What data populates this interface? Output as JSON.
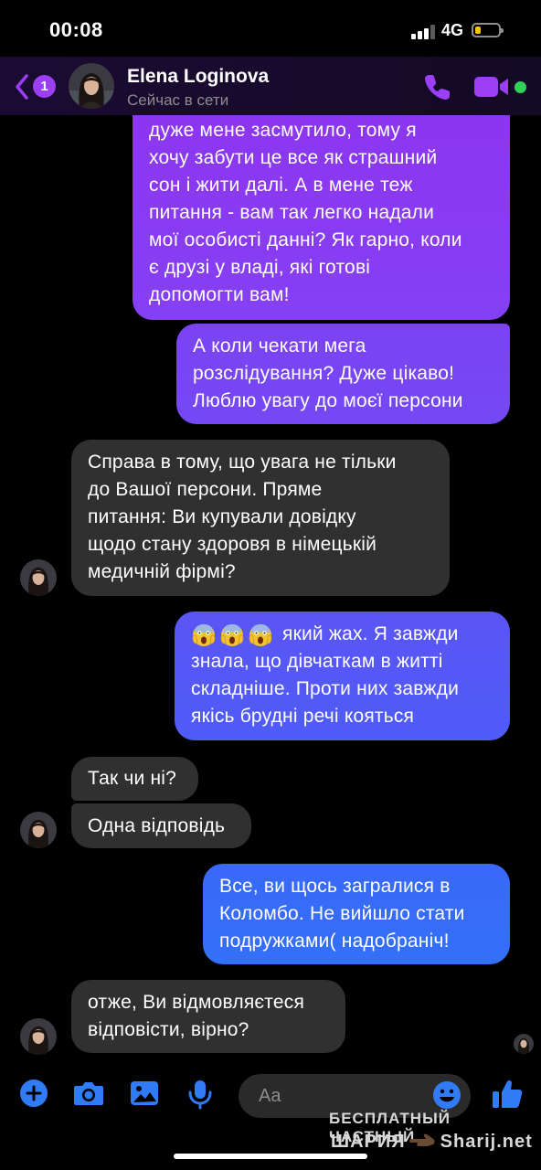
{
  "status_bar": {
    "time": "00:08",
    "network": "4G"
  },
  "header": {
    "unread_count": "1",
    "contact_name": "Elena Loginova",
    "contact_status": "Сейчас в сети",
    "accent_color": "#9a3ff5",
    "online_color": "#31d158"
  },
  "messages": [
    {
      "direction": "outgoing",
      "lines": [
        "дуже мене засмутило, тому я",
        "хочу забути це все як страшний",
        "сон і жити далі. А в мене теж",
        "питання - вам так легко надали",
        "мої особисті данні? Як гарно, коли",
        "є друзі у владі, які готові",
        "допомогти вам!"
      ]
    },
    {
      "direction": "outgoing",
      "lines": [
        "А коли чекати мега",
        "розслідування? Дуже цікаво!",
        "Люблю увагу до моєї персони"
      ]
    },
    {
      "direction": "incoming",
      "lines": [
        "Справа в тому, що увага не тільки",
        "до Вашої персони. Пряме",
        "питання: Ви купували довідку",
        "щодо стану здоровя в німецькій",
        "медичній  фірмі?"
      ]
    },
    {
      "direction": "outgoing",
      "emoji": [
        "screaming-face",
        "screaming-face",
        "screaming-face"
      ],
      "lines": [
        "який жах. Я завжди",
        "знала, що дівчаткам в житті",
        "складніше. Проти них завжди",
        "якісь брудні речі кояться"
      ]
    },
    {
      "direction": "incoming",
      "lines": [
        "Так чи ні?"
      ]
    },
    {
      "direction": "incoming",
      "lines": [
        "Одна відповідь"
      ]
    },
    {
      "direction": "outgoing",
      "lines": [
        "Все, ви щось загралися в",
        "Коломбо. Не вийшло стати",
        "подружками( надобраніч!"
      ]
    },
    {
      "direction": "incoming",
      "lines": [
        "отже, Ви відмовляєтеся",
        "відповісти, вірно?"
      ]
    }
  ],
  "composer": {
    "placeholder": "Aa",
    "icons": [
      "plus-icon",
      "camera-icon",
      "gallery-icon",
      "microphone-icon",
      "emoji-icon",
      "thumbs-up-icon"
    ]
  },
  "watermark": {
    "line1": "БЕСПЛАТНЫЙ ЧАСТНЫЙ",
    "line2_left": "ШАРИЯ",
    "line2_right": "Sharij.net"
  }
}
